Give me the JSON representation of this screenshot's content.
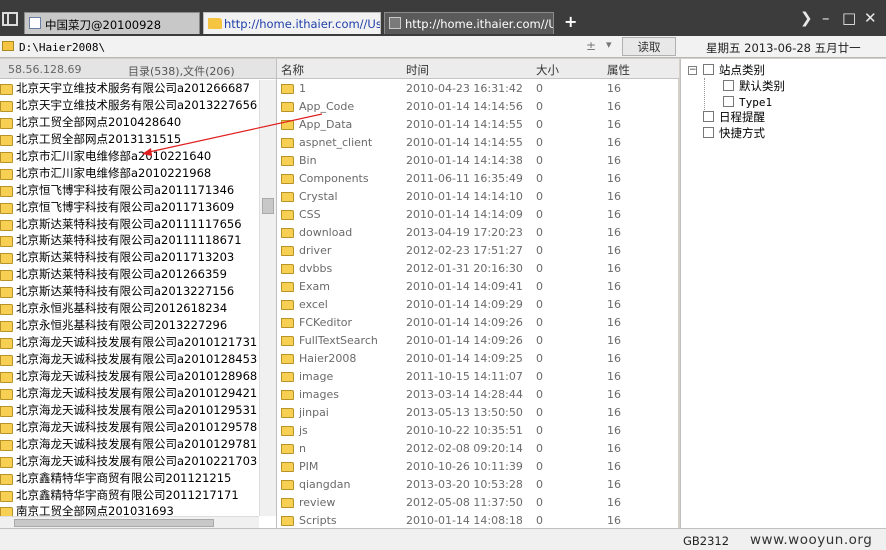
{
  "tabs": [
    {
      "label": "中国菜刀@20100928"
    },
    {
      "label": "http://home.ithaier.com//Use..."
    },
    {
      "label": "http://home.ithaier.com//Use..."
    }
  ],
  "address": {
    "path": "D:\\Haier2008\\",
    "read_label": "读取",
    "date": "星期五 2013-06-28 五月廿一"
  },
  "left_panel": {
    "ip": "58.56.128.69",
    "count_text": "目录(538),文件(206)",
    "items": [
      "北京天宇立维技术服务有限公司a201266687",
      "北京天宇立维技术服务有限公司a2013227656",
      "北京工贸全部网点2010428640",
      "北京工贸全部网点2013131515",
      "北京市汇川家电维修部a2010221640",
      "北京市汇川家电维修部a2010221968",
      "北京恒飞博宇科技有限公司a2011171346",
      "北京恒飞博宇科技有限公司a2011713609",
      "北京斯达莱特科技有限公司a20111117656",
      "北京斯达莱特科技有限公司a20111118671",
      "北京斯达莱特科技有限公司a2011713203",
      "北京斯达莱特科技有限公司a201266359",
      "北京斯达莱特科技有限公司a2013227156",
      "北京永恒兆基科技有限公司2012618234",
      "北京永恒兆基科技有限公司2013227296",
      "北京海龙天诚科技发展有限公司a2010121731",
      "北京海龙天诚科技发展有限公司a2010128453",
      "北京海龙天诚科技发展有限公司a2010128968",
      "北京海龙天诚科技发展有限公司a2010129421",
      "北京海龙天诚科技发展有限公司a2010129531",
      "北京海龙天诚科技发展有限公司a2010129578",
      "北京海龙天诚科技发展有限公司a2010129781",
      "北京海龙天诚科技发展有限公司a2010221703",
      "北京鑫精特华宇商贸有限公司201121215",
      "北京鑫精特华宇商贸有限公司2011217171",
      "南京工贸全部网点201031693"
    ]
  },
  "file_table": {
    "columns": {
      "name": "名称",
      "time": "时间",
      "size": "大小",
      "attr": "属性"
    },
    "rows": [
      {
        "name": "1",
        "time": "2010-04-23 16:31:42",
        "size": "0",
        "attr": "16"
      },
      {
        "name": "App_Code",
        "time": "2010-01-14 14:14:56",
        "size": "0",
        "attr": "16"
      },
      {
        "name": "App_Data",
        "time": "2010-01-14 14:14:55",
        "size": "0",
        "attr": "16"
      },
      {
        "name": "aspnet_client",
        "time": "2010-01-14 14:14:55",
        "size": "0",
        "attr": "16"
      },
      {
        "name": "Bin",
        "time": "2010-01-14 14:14:38",
        "size": "0",
        "attr": "16"
      },
      {
        "name": "Components",
        "time": "2011-06-11 16:35:49",
        "size": "0",
        "attr": "16"
      },
      {
        "name": "Crystal",
        "time": "2010-01-14 14:14:10",
        "size": "0",
        "attr": "16"
      },
      {
        "name": "CSS",
        "time": "2010-01-14 14:14:09",
        "size": "0",
        "attr": "16"
      },
      {
        "name": "download",
        "time": "2013-04-19 17:20:23",
        "size": "0",
        "attr": "16"
      },
      {
        "name": "driver",
        "time": "2012-02-23 17:51:27",
        "size": "0",
        "attr": "16"
      },
      {
        "name": "dvbbs",
        "time": "2012-01-31 20:16:30",
        "size": "0",
        "attr": "16"
      },
      {
        "name": "Exam",
        "time": "2010-01-14 14:09:41",
        "size": "0",
        "attr": "16"
      },
      {
        "name": "excel",
        "time": "2010-01-14 14:09:29",
        "size": "0",
        "attr": "16"
      },
      {
        "name": "FCKeditor",
        "time": "2010-01-14 14:09:26",
        "size": "0",
        "attr": "16"
      },
      {
        "name": "FullTextSearch",
        "time": "2010-01-14 14:09:26",
        "size": "0",
        "attr": "16"
      },
      {
        "name": "Haier2008",
        "time": "2010-01-14 14:09:25",
        "size": "0",
        "attr": "16"
      },
      {
        "name": "image",
        "time": "2011-10-15 14:11:07",
        "size": "0",
        "attr": "16"
      },
      {
        "name": "images",
        "time": "2013-03-14 14:28:44",
        "size": "0",
        "attr": "16"
      },
      {
        "name": "jinpai",
        "time": "2013-05-13 13:50:50",
        "size": "0",
        "attr": "16"
      },
      {
        "name": "js",
        "time": "2010-10-22 10:35:51",
        "size": "0",
        "attr": "16"
      },
      {
        "name": "n",
        "time": "2012-02-08 09:20:14",
        "size": "0",
        "attr": "16"
      },
      {
        "name": "PIM",
        "time": "2010-10-26 10:11:39",
        "size": "0",
        "attr": "16"
      },
      {
        "name": "qiangdan",
        "time": "2013-03-20 10:53:28",
        "size": "0",
        "attr": "16"
      },
      {
        "name": "review",
        "time": "2012-05-08 11:37:50",
        "size": "0",
        "attr": "16"
      },
      {
        "name": "Scripts",
        "time": "2010-01-14 14:08:18",
        "size": "0",
        "attr": "16"
      }
    ]
  },
  "tree": {
    "root": "站点类别",
    "children": [
      "默认类别",
      "Type1"
    ],
    "items": [
      "日程提醒",
      "快捷方式"
    ]
  },
  "status": {
    "encoding": "GB2312",
    "watermark": "www.wooyun.org"
  },
  "colors": {
    "annotation_arrow": "#e02020",
    "folder": "#f7cf52",
    "tab_active_text": "#1f3fa8"
  }
}
